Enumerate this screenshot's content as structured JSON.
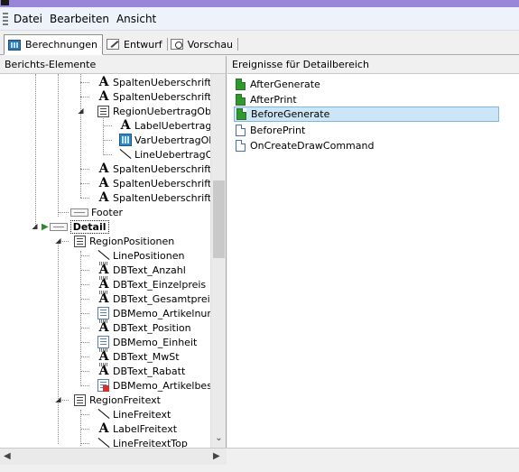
{
  "menu": {
    "items": [
      "Datei",
      "Bearbeiten",
      "Ansicht"
    ]
  },
  "tabs": [
    {
      "label": "Berechnungen",
      "icon": "calculator-icon",
      "active": true
    },
    {
      "label": "Entwurf",
      "icon": "pen-icon",
      "active": false
    },
    {
      "label": "Vorschau",
      "icon": "preview-icon",
      "active": false
    }
  ],
  "left_panel": {
    "title": "Berichts-Elemente",
    "items": [
      {
        "label": "SpaltenUeberschrift_A",
        "icon": "text-a-icon"
      },
      {
        "label": "SpaltenUeberschrift_E",
        "icon": "text-a-icon"
      },
      {
        "label": "RegionUebertragOber",
        "icon": "region-icon"
      },
      {
        "label": "LabelUebertragO",
        "icon": "text-a-icon"
      },
      {
        "label": "VarUebertragObe",
        "icon": "variable-icon"
      },
      {
        "label": "LineUebertragOb",
        "icon": "line-icon"
      },
      {
        "label": "SpaltenUeberschrift_F",
        "icon": "text-a-icon"
      },
      {
        "label": "SpaltenUeberschrift_M",
        "icon": "text-a-icon"
      },
      {
        "label": "SpaltenUeberschrift_R",
        "icon": "text-a-icon"
      },
      {
        "label": "Footer",
        "icon": "band-icon"
      },
      {
        "label": "Detail",
        "icon": "band-icon"
      },
      {
        "label": "RegionPositionen",
        "icon": "region-icon"
      },
      {
        "label": "LinePositionen",
        "icon": "line-icon"
      },
      {
        "label": "DBText_Anzahl",
        "icon": "dbtext-icon"
      },
      {
        "label": "DBText_Einzelpreis",
        "icon": "dbtext-icon"
      },
      {
        "label": "DBText_Gesamtpreis",
        "icon": "dbtext-icon"
      },
      {
        "label": "DBMemo_Artikelnumm",
        "icon": "memo-icon"
      },
      {
        "label": "DBText_Position",
        "icon": "dbtext-icon"
      },
      {
        "label": "DBMemo_Einheit",
        "icon": "memo-icon"
      },
      {
        "label": "DBText_MwSt",
        "icon": "dbtext-icon"
      },
      {
        "label": "DBText_Rabatt",
        "icon": "dbtext-icon"
      },
      {
        "label": "DBMemo_Artikelbesch",
        "icon": "memo-red-icon"
      },
      {
        "label": "RegionFreitext",
        "icon": "region-icon"
      },
      {
        "label": "LineFreitext",
        "icon": "line-icon"
      },
      {
        "label": "LabelFreitext",
        "icon": "text-a-icon"
      },
      {
        "label": "LineFreitextTop",
        "icon": "line-icon"
      }
    ]
  },
  "right_panel": {
    "title": "Ereignisse für Detailbereich",
    "events": [
      {
        "label": "AfterGenerate",
        "icon": "event-set-icon",
        "selected": false
      },
      {
        "label": "AfterPrint",
        "icon": "event-set-icon",
        "selected": false
      },
      {
        "label": "BeforeGenerate",
        "icon": "event-set-icon",
        "selected": true
      },
      {
        "label": "BeforePrint",
        "icon": "event-empty-icon",
        "selected": false
      },
      {
        "label": "OnCreateDrawCommand",
        "icon": "event-empty-icon",
        "selected": false
      }
    ]
  },
  "colors": {
    "title_strip": "#9a86d8",
    "selection": "#cde6f7",
    "event_set": "#2e9a2e"
  }
}
